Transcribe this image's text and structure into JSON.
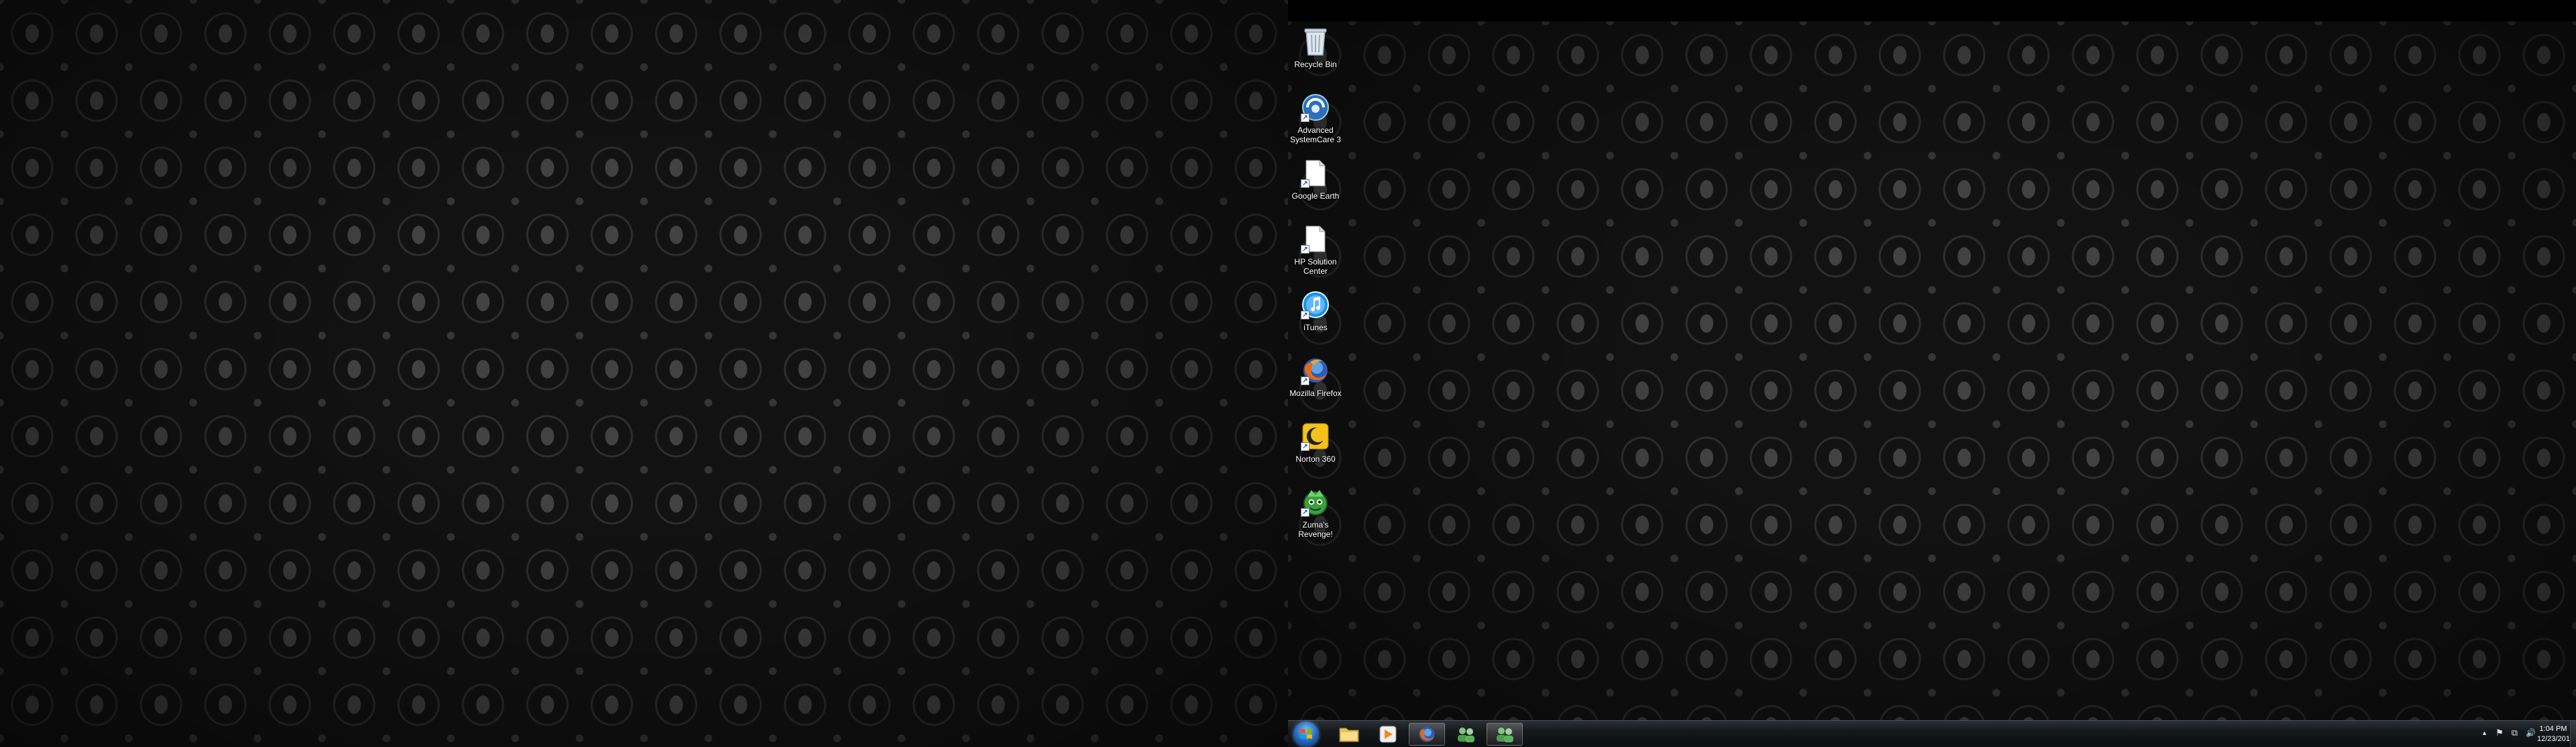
{
  "desktop": {
    "icons": [
      {
        "label": "Recycle Bin",
        "icon": "recycle-bin-icon"
      },
      {
        "label": "Advanced SystemCare 3",
        "icon": "advanced-systemcare-icon"
      },
      {
        "label": "Google Earth",
        "icon": "blank-document-icon"
      },
      {
        "label": "HP Solution Center",
        "icon": "blank-document-icon"
      },
      {
        "label": "iTunes",
        "icon": "itunes-icon"
      },
      {
        "label": "Mozilla Firefox",
        "icon": "firefox-icon"
      },
      {
        "label": "Norton 360",
        "icon": "norton-icon"
      },
      {
        "label": "Zuma's Revenge!",
        "icon": "zuma-icon"
      }
    ]
  },
  "taskbar": {
    "pinned": [
      {
        "name": "windows-explorer-button",
        "icon": "folder-icon"
      },
      {
        "name": "media-player-button",
        "icon": "media-player-icon"
      },
      {
        "name": "firefox-button",
        "icon": "firefox-icon",
        "active": true
      },
      {
        "name": "network-users-button",
        "icon": "users-icon"
      },
      {
        "name": "network-users-button-2",
        "icon": "users-icon",
        "active": true
      }
    ],
    "tray": {
      "show_hidden": "▲",
      "action_center": "⚑",
      "network": "⧉",
      "volume": "🔊"
    },
    "clock": {
      "time": "1:04 PM",
      "date": "12/23/2011"
    }
  },
  "colors": {
    "taskbar": "#15181c",
    "wallpaper": "#121212",
    "start_orb": "#1e63b8"
  }
}
